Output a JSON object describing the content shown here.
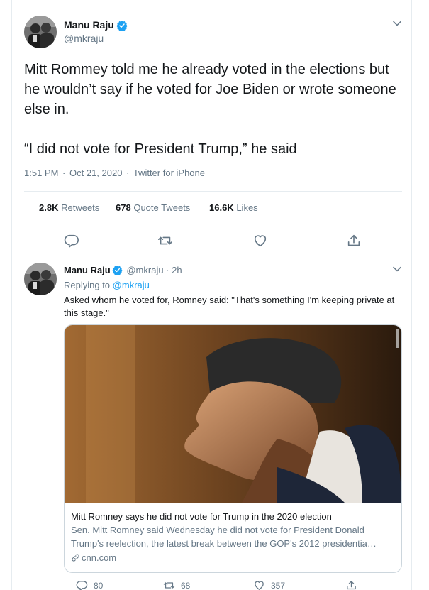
{
  "main_tweet": {
    "author_name": "Manu Raju",
    "author_handle": "@mkraju",
    "text_lines": [
      "Mitt Rommey told me he already voted in the elections but he wouldn’t say if he voted for Joe Biden or wrote someone else in.",
      "“I did not vote for President Trump,” he said"
    ],
    "time": "1:51 PM",
    "date": "Oct 21, 2020",
    "source": "Twitter for iPhone",
    "separator": "·",
    "stats": {
      "retweets_count": "2.8K",
      "retweets_label": "Retweets",
      "quotes_count": "678",
      "quotes_label": "Quote Tweets",
      "likes_count": "16.6K",
      "likes_label": "Likes"
    }
  },
  "reply_tweet": {
    "author_name": "Manu Raju",
    "author_handle": "@mkraju",
    "time_ago": "2h",
    "separator": "·",
    "replying_prefix": "Replying to",
    "replying_to": "@mkraju",
    "text": "Asked whom he voted for, Romney said: \"That's something I'm keeping private at this stage.\"",
    "card": {
      "title": "Mitt Romney says he did not vote for Trump in the 2020 election",
      "description": "Sen. Mitt Romney said Wednesday he did not vote for President Donald Trump's reelection, the latest break between the GOP's 2012 presidentia…",
      "domain": "cnn.com"
    },
    "actions": {
      "reply_count": "80",
      "retweet_count": "68",
      "like_count": "357"
    }
  },
  "colors": {
    "accent": "#1da1f2",
    "secondary_text": "#657786",
    "border": "#e6ecf0"
  },
  "icons": [
    "verified-badge-icon",
    "chevron-down-icon",
    "reply-icon",
    "retweet-icon",
    "like-icon",
    "share-icon",
    "link-icon"
  ]
}
